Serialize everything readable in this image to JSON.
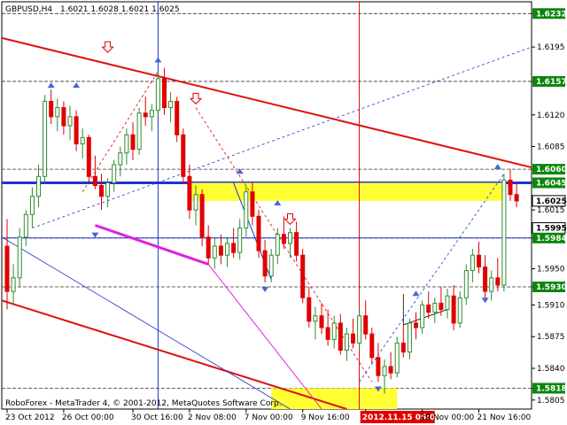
{
  "header": {
    "symbol": "GBPUSD,H4",
    "ohlc": "1.6021 1.6028 1.6021 1.6025"
  },
  "watermark": "RoboForex - MetaTrader 4, © 2001-2012, MetaQuotes Software Corp.",
  "colors": {
    "bull": "#2e8b2e",
    "bear": "#e00000",
    "channel": "#dd1111",
    "support": "#2233cc",
    "magenta": "#dd22dd",
    "yellow_zone": "#ffff33",
    "tag_bg": "#0c860c"
  },
  "chart_data": {
    "type": "candlestick",
    "timeframe": "H4",
    "ylim": [
      1.5795,
      1.6245
    ],
    "y_ticks": [
      1.6232,
      1.6195,
      1.6157,
      1.612,
      1.6085,
      1.606,
      1.6045,
      1.6025,
      1.6015,
      1.5995,
      1.5984,
      1.595,
      1.593,
      1.591,
      1.5875,
      1.584,
      1.5818,
      1.5805
    ],
    "x_ticks": [
      "23 Oct 2012",
      "26 Oct 00:00",
      "30 Oct 16:00",
      "2 Nov 08:00",
      "7 Nov 00:00",
      "9 Nov 16:00",
      "2012.11.15 05:00",
      "19 Nov 00:00",
      "21 Nov 16:00"
    ],
    "price_tags": [
      1.6232,
      1.6157,
      1.606,
      1.6045,
      1.6025,
      1.5995,
      1.5984,
      1.593,
      1.5818
    ],
    "highlight_time": "2012.11.15 05:00",
    "horizontal_levels": [
      1.6232,
      1.6157,
      1.606,
      1.6045,
      1.5984,
      1.593,
      1.5818
    ],
    "candles": [
      {
        "o": 1.5975,
        "h": 1.6005,
        "l": 1.5905,
        "c": 1.5925
      },
      {
        "o": 1.5925,
        "h": 1.5955,
        "l": 1.5912,
        "c": 1.594
      },
      {
        "o": 1.594,
        "h": 1.5995,
        "l": 1.593,
        "c": 1.5985
      },
      {
        "o": 1.5985,
        "h": 1.6015,
        "l": 1.5975,
        "c": 1.601
      },
      {
        "o": 1.601,
        "h": 1.604,
        "l": 1.5995,
        "c": 1.603
      },
      {
        "o": 1.603,
        "h": 1.6065,
        "l": 1.6018,
        "c": 1.6052
      },
      {
        "o": 1.6052,
        "h": 1.6142,
        "l": 1.6045,
        "c": 1.6135
      },
      {
        "o": 1.6135,
        "h": 1.6148,
        "l": 1.611,
        "c": 1.6118
      },
      {
        "o": 1.6118,
        "h": 1.6138,
        "l": 1.6102,
        "c": 1.6128
      },
      {
        "o": 1.6128,
        "h": 1.6135,
        "l": 1.6098,
        "c": 1.6108
      },
      {
        "o": 1.6108,
        "h": 1.613,
        "l": 1.6092,
        "c": 1.6118
      },
      {
        "o": 1.6118,
        "h": 1.6125,
        "l": 1.608,
        "c": 1.6088
      },
      {
        "o": 1.6088,
        "h": 1.6105,
        "l": 1.6072,
        "c": 1.6095
      },
      {
        "o": 1.6095,
        "h": 1.6098,
        "l": 1.6045,
        "c": 1.6052
      },
      {
        "o": 1.6052,
        "h": 1.6075,
        "l": 1.6038,
        "c": 1.6042
      },
      {
        "o": 1.6042,
        "h": 1.6055,
        "l": 1.6015,
        "c": 1.603
      },
      {
        "o": 1.603,
        "h": 1.605,
        "l": 1.6018,
        "c": 1.6045
      },
      {
        "o": 1.6045,
        "h": 1.607,
        "l": 1.6035,
        "c": 1.6065
      },
      {
        "o": 1.6065,
        "h": 1.6085,
        "l": 1.6052,
        "c": 1.6078
      },
      {
        "o": 1.6078,
        "h": 1.6105,
        "l": 1.6065,
        "c": 1.6098
      },
      {
        "o": 1.6098,
        "h": 1.6112,
        "l": 1.607,
        "c": 1.6082
      },
      {
        "o": 1.6082,
        "h": 1.6128,
        "l": 1.6076,
        "c": 1.6122
      },
      {
        "o": 1.6122,
        "h": 1.614,
        "l": 1.6108,
        "c": 1.6118
      },
      {
        "o": 1.6118,
        "h": 1.6132,
        "l": 1.6102,
        "c": 1.6125
      },
      {
        "o": 1.6125,
        "h": 1.6168,
        "l": 1.6118,
        "c": 1.616
      },
      {
        "o": 1.616,
        "h": 1.6172,
        "l": 1.612,
        "c": 1.6128
      },
      {
        "o": 1.6128,
        "h": 1.6145,
        "l": 1.6112,
        "c": 1.6135
      },
      {
        "o": 1.6135,
        "h": 1.614,
        "l": 1.609,
        "c": 1.6098
      },
      {
        "o": 1.6098,
        "h": 1.6105,
        "l": 1.6045,
        "c": 1.6052
      },
      {
        "o": 1.6052,
        "h": 1.6065,
        "l": 1.6005,
        "c": 1.6015
      },
      {
        "o": 1.6015,
        "h": 1.6042,
        "l": 1.5998,
        "c": 1.6032
      },
      {
        "o": 1.6032,
        "h": 1.6038,
        "l": 1.5975,
        "c": 1.5985
      },
      {
        "o": 1.5985,
        "h": 1.5998,
        "l": 1.5955,
        "c": 1.5962
      },
      {
        "o": 1.5962,
        "h": 1.5985,
        "l": 1.595,
        "c": 1.5975
      },
      {
        "o": 1.5975,
        "h": 1.5988,
        "l": 1.5955,
        "c": 1.5965
      },
      {
        "o": 1.5965,
        "h": 1.5985,
        "l": 1.5952,
        "c": 1.5978
      },
      {
        "o": 1.5978,
        "h": 1.5995,
        "l": 1.5962,
        "c": 1.5968
      },
      {
        "o": 1.5968,
        "h": 1.6005,
        "l": 1.596,
        "c": 1.5995
      },
      {
        "o": 1.5995,
        "h": 1.6042,
        "l": 1.5985,
        "c": 1.6035
      },
      {
        "o": 1.6035,
        "h": 1.6045,
        "l": 1.5998,
        "c": 1.6008
      },
      {
        "o": 1.6008,
        "h": 1.6015,
        "l": 1.5962,
        "c": 1.597
      },
      {
        "o": 1.597,
        "h": 1.5982,
        "l": 1.5935,
        "c": 1.5942
      },
      {
        "o": 1.5942,
        "h": 1.5972,
        "l": 1.5935,
        "c": 1.5965
      },
      {
        "o": 1.5965,
        "h": 1.5995,
        "l": 1.5955,
        "c": 1.5988
      },
      {
        "o": 1.5988,
        "h": 1.6008,
        "l": 1.5972,
        "c": 1.5978
      },
      {
        "o": 1.5978,
        "h": 1.5995,
        "l": 1.5962,
        "c": 1.599
      },
      {
        "o": 1.599,
        "h": 1.6002,
        "l": 1.5958,
        "c": 1.5965
      },
      {
        "o": 1.5965,
        "h": 1.5972,
        "l": 1.5912,
        "c": 1.5918
      },
      {
        "o": 1.5918,
        "h": 1.593,
        "l": 1.5885,
        "c": 1.5892
      },
      {
        "o": 1.5892,
        "h": 1.5908,
        "l": 1.5872,
        "c": 1.5898
      },
      {
        "o": 1.5898,
        "h": 1.5912,
        "l": 1.5878,
        "c": 1.5885
      },
      {
        "o": 1.5885,
        "h": 1.5905,
        "l": 1.5865,
        "c": 1.5872
      },
      {
        "o": 1.5872,
        "h": 1.5898,
        "l": 1.5862,
        "c": 1.589
      },
      {
        "o": 1.589,
        "h": 1.59,
        "l": 1.5855,
        "c": 1.586
      },
      {
        "o": 1.586,
        "h": 1.5885,
        "l": 1.5848,
        "c": 1.5878
      },
      {
        "o": 1.5878,
        "h": 1.5895,
        "l": 1.5862,
        "c": 1.5868
      },
      {
        "o": 1.5868,
        "h": 1.5905,
        "l": 1.586,
        "c": 1.5898
      },
      {
        "o": 1.5898,
        "h": 1.5915,
        "l": 1.5872,
        "c": 1.5878
      },
      {
        "o": 1.5878,
        "h": 1.5885,
        "l": 1.5845,
        "c": 1.5852
      },
      {
        "o": 1.5852,
        "h": 1.5868,
        "l": 1.5825,
        "c": 1.5832
      },
      {
        "o": 1.5832,
        "h": 1.585,
        "l": 1.5812,
        "c": 1.5842
      },
      {
        "o": 1.5842,
        "h": 1.5858,
        "l": 1.5828,
        "c": 1.5835
      },
      {
        "o": 1.5835,
        "h": 1.5875,
        "l": 1.583,
        "c": 1.5868
      },
      {
        "o": 1.5868,
        "h": 1.5888,
        "l": 1.5852,
        "c": 1.5858
      },
      {
        "o": 1.5858,
        "h": 1.5895,
        "l": 1.585,
        "c": 1.589
      },
      {
        "o": 1.589,
        "h": 1.5902,
        "l": 1.5872,
        "c": 1.5885
      },
      {
        "o": 1.5885,
        "h": 1.5915,
        "l": 1.5878,
        "c": 1.591
      },
      {
        "o": 1.591,
        "h": 1.5925,
        "l": 1.5895,
        "c": 1.5902
      },
      {
        "o": 1.5902,
        "h": 1.5918,
        "l": 1.589,
        "c": 1.5912
      },
      {
        "o": 1.5912,
        "h": 1.593,
        "l": 1.5898,
        "c": 1.5905
      },
      {
        "o": 1.5905,
        "h": 1.5928,
        "l": 1.5895,
        "c": 1.592
      },
      {
        "o": 1.592,
        "h": 1.5932,
        "l": 1.5882,
        "c": 1.589
      },
      {
        "o": 1.589,
        "h": 1.5925,
        "l": 1.5885,
        "c": 1.5918
      },
      {
        "o": 1.5918,
        "h": 1.5955,
        "l": 1.591,
        "c": 1.5948
      },
      {
        "o": 1.5948,
        "h": 1.5972,
        "l": 1.5935,
        "c": 1.5965
      },
      {
        "o": 1.5965,
        "h": 1.598,
        "l": 1.5945,
        "c": 1.5952
      },
      {
        "o": 1.5952,
        "h": 1.5965,
        "l": 1.5918,
        "c": 1.5925
      },
      {
        "o": 1.5925,
        "h": 1.5948,
        "l": 1.5915,
        "c": 1.594
      },
      {
        "o": 1.594,
        "h": 1.5962,
        "l": 1.5925,
        "c": 1.5932
      },
      {
        "o": 1.5932,
        "h": 1.6055,
        "l": 1.5925,
        "c": 1.6048
      },
      {
        "o": 1.6048,
        "h": 1.606,
        "l": 1.6025,
        "c": 1.6032
      },
      {
        "o": 1.6032,
        "h": 1.6045,
        "l": 1.6018,
        "c": 1.6025
      }
    ]
  }
}
